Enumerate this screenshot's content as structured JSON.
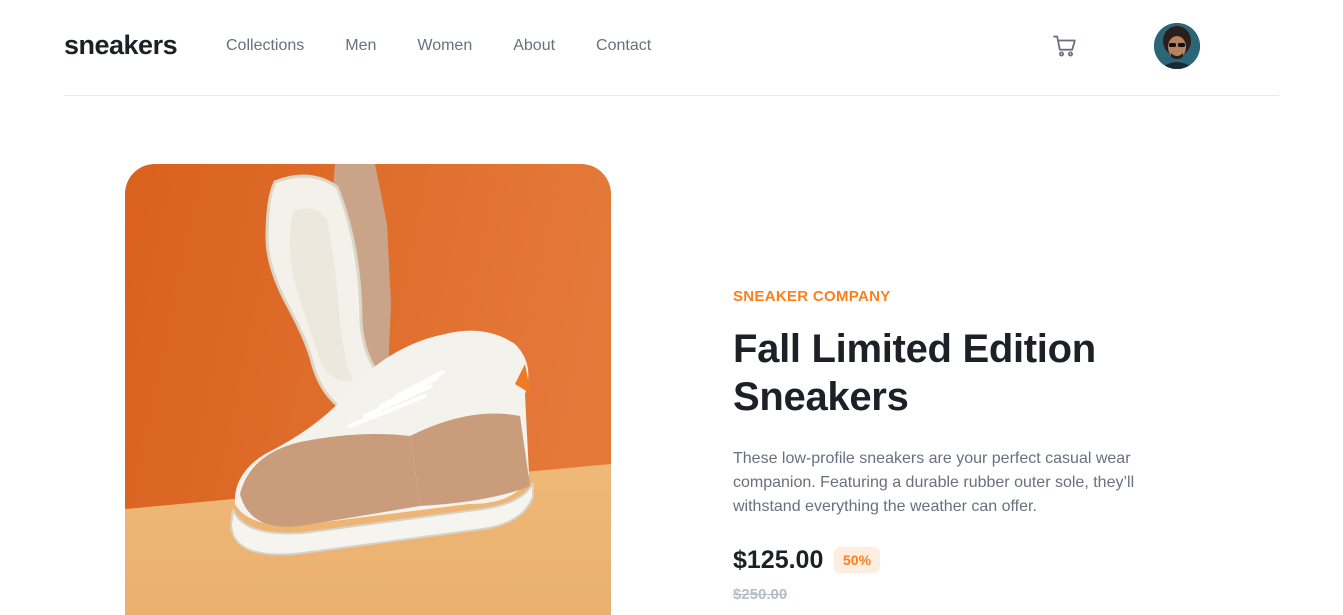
{
  "header": {
    "logo": "sneakers",
    "nav": [
      "Collections",
      "Men",
      "Women",
      "About",
      "Contact"
    ]
  },
  "product": {
    "company": "SNEAKER COMPANY",
    "title": "Fall Limited Edition Sneakers",
    "description": "These low-profile sneakers are your perfect casual wear companion. Featuring a durable rubber outer sole, they’ll withstand everything the weather can offer.",
    "price": "$125.00",
    "discount": "50%",
    "original_price": "$250.00"
  },
  "colors": {
    "accent": "#ff7e1b",
    "accent_pale": "#ffede0",
    "text_dark": "#1d2026",
    "text_muted": "#69707d"
  },
  "icons": [
    "cart-icon",
    "avatar"
  ]
}
